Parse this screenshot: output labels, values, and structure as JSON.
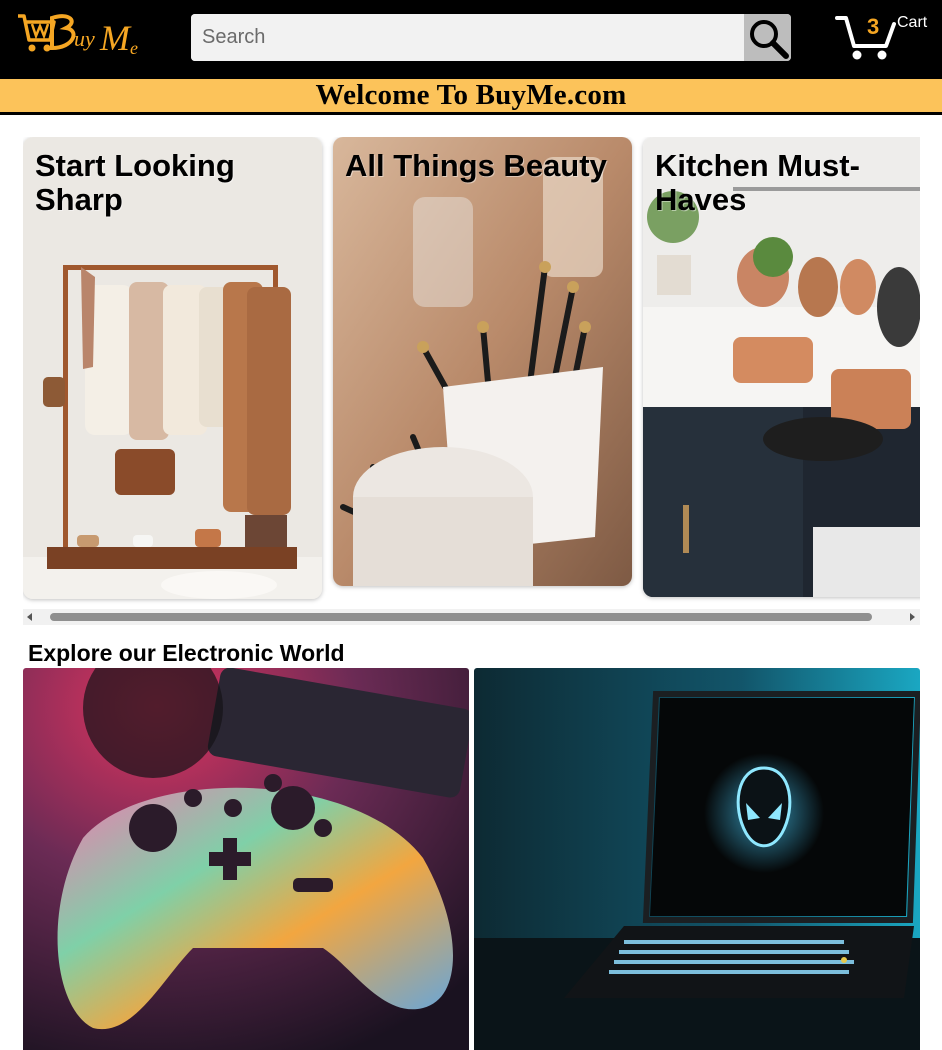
{
  "header": {
    "logo_text": "BuyMe",
    "logo_icon": "cart-logo-icon",
    "search": {
      "placeholder": "Search",
      "value": "",
      "button_icon": "magnifier-icon"
    },
    "cart": {
      "count": "3",
      "label": "Cart",
      "icon": "cart-icon"
    }
  },
  "banner": {
    "text": "Welcome To BuyMe.com"
  },
  "categories": [
    {
      "title": "Start Looking Sharp",
      "image": "clothing-rack-photo"
    },
    {
      "title": "All Things Beauty",
      "image": "makeup-brushes-photo"
    },
    {
      "title": "Kitchen Must-Haves",
      "image": "copper-cookware-photo"
    }
  ],
  "electronics": {
    "title": "Explore our Electronic World",
    "tiles": [
      {
        "image": "game-controller-photo"
      },
      {
        "image": "gaming-laptop-photo"
      }
    ]
  },
  "colors": {
    "header_bg": "#000000",
    "banner_bg": "#fcc35a",
    "accent": "#f5a623"
  }
}
